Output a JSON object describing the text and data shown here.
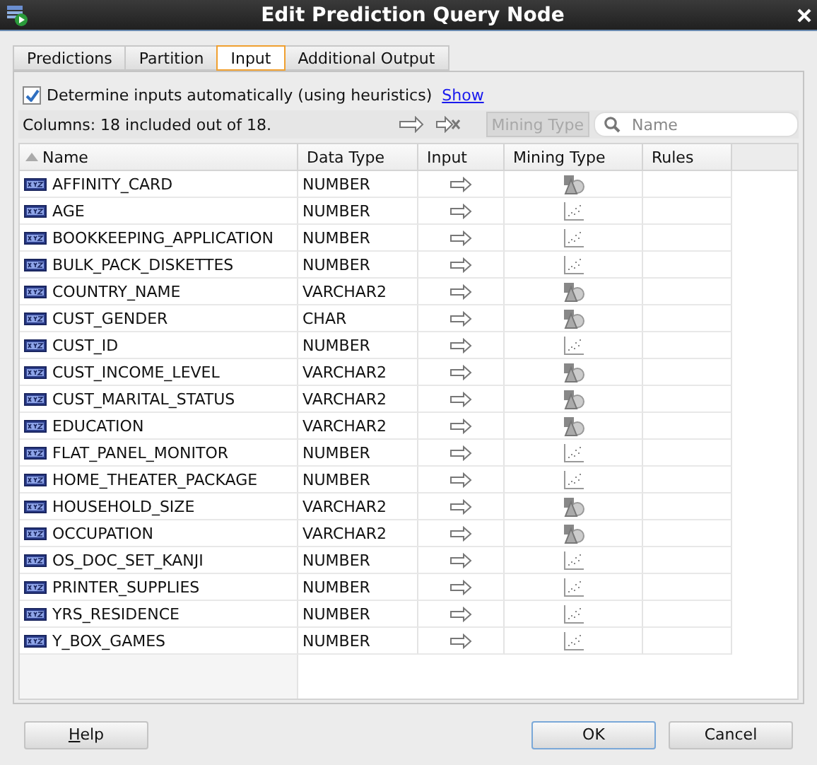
{
  "window": {
    "title": "Edit Prediction Query Node"
  },
  "tabs": [
    {
      "label": "Predictions",
      "selected": false
    },
    {
      "label": "Partition",
      "selected": false
    },
    {
      "label": "Input",
      "selected": true
    },
    {
      "label": "Additional Output",
      "selected": false
    }
  ],
  "auto_inputs": {
    "label": "Determine inputs automatically (using heuristics)",
    "checked": true,
    "link": "Show"
  },
  "toolbar": {
    "summary": "Columns: 18 included out of 18.",
    "filter_button": "Mining Type",
    "search": {
      "placeholder": "Name"
    }
  },
  "table": {
    "columns": [
      "Name",
      "Data Type",
      "Input",
      "Mining Type",
      "Rules"
    ],
    "rows": [
      {
        "name": "AFFINITY_CARD",
        "data_type": "NUMBER",
        "kind": "categorical"
      },
      {
        "name": "AGE",
        "data_type": "NUMBER",
        "kind": "numerical"
      },
      {
        "name": "BOOKKEEPING_APPLICATION",
        "data_type": "NUMBER",
        "kind": "numerical"
      },
      {
        "name": "BULK_PACK_DISKETTES",
        "data_type": "NUMBER",
        "kind": "numerical"
      },
      {
        "name": "COUNTRY_NAME",
        "data_type": "VARCHAR2",
        "kind": "categorical"
      },
      {
        "name": "CUST_GENDER",
        "data_type": "CHAR",
        "kind": "categorical"
      },
      {
        "name": "CUST_ID",
        "data_type": "NUMBER",
        "kind": "numerical"
      },
      {
        "name": "CUST_INCOME_LEVEL",
        "data_type": "VARCHAR2",
        "kind": "categorical"
      },
      {
        "name": "CUST_MARITAL_STATUS",
        "data_type": "VARCHAR2",
        "kind": "categorical"
      },
      {
        "name": "EDUCATION",
        "data_type": "VARCHAR2",
        "kind": "categorical"
      },
      {
        "name": "FLAT_PANEL_MONITOR",
        "data_type": "NUMBER",
        "kind": "numerical"
      },
      {
        "name": "HOME_THEATER_PACKAGE",
        "data_type": "NUMBER",
        "kind": "numerical"
      },
      {
        "name": "HOUSEHOLD_SIZE",
        "data_type": "VARCHAR2",
        "kind": "categorical"
      },
      {
        "name": "OCCUPATION",
        "data_type": "VARCHAR2",
        "kind": "categorical"
      },
      {
        "name": "OS_DOC_SET_KANJI",
        "data_type": "NUMBER",
        "kind": "numerical"
      },
      {
        "name": "PRINTER_SUPPLIES",
        "data_type": "NUMBER",
        "kind": "numerical"
      },
      {
        "name": "YRS_RESIDENCE",
        "data_type": "NUMBER",
        "kind": "numerical"
      },
      {
        "name": "Y_BOX_GAMES",
        "data_type": "NUMBER",
        "kind": "numerical"
      }
    ]
  },
  "buttons": [
    {
      "label": "Help",
      "kind": "secondary"
    },
    {
      "label": "OK",
      "kind": "default"
    },
    {
      "label": "Cancel",
      "kind": "secondary"
    }
  ]
}
